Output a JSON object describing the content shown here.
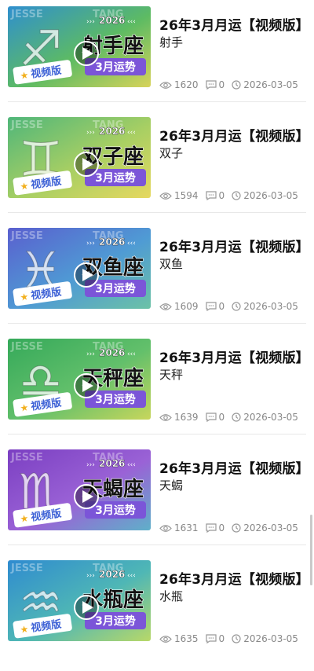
{
  "items": [
    {
      "title": "26年3月月运【视频版】",
      "subtitle": "射手",
      "views": "1620",
      "comments": "0",
      "date": "2026-03-05",
      "thumb": {
        "sign_name": "射手座",
        "year": "2026",
        "label": "3月运势",
        "badge": "视频版",
        "glyph": "♐",
        "watermark_left": "JESSE",
        "watermark_right": "TANG",
        "bg_a": "#2f8fcf",
        "bg_b": "#5dbb63",
        "bg_c": "#d7d35a",
        "symbol": "sagittarius-icon"
      }
    },
    {
      "title": "26年3月月运【视频版】",
      "subtitle": "双子",
      "views": "1594",
      "comments": "0",
      "date": "2026-03-05",
      "thumb": {
        "sign_name": "双子座",
        "year": "2026",
        "label": "3月运势",
        "badge": "视频版",
        "glyph": "♊",
        "watermark_left": "JESSE",
        "watermark_right": "TANG",
        "bg_a": "#4fb67a",
        "bg_b": "#a8cf63",
        "bg_c": "#e6d860",
        "symbol": "gemini-icon"
      }
    },
    {
      "title": "26年3月月运【视频版】",
      "subtitle": "双鱼",
      "views": "1609",
      "comments": "0",
      "date": "2026-03-05",
      "thumb": {
        "sign_name": "双鱼座",
        "year": "2026",
        "label": "3月运势",
        "badge": "视频版",
        "glyph": "♓",
        "watermark_left": "JESSE",
        "watermark_right": "TANG",
        "bg_a": "#5a5fcf",
        "bg_b": "#4f9bd4",
        "bg_c": "#6cc2a6",
        "symbol": "pisces-icon"
      }
    },
    {
      "title": "26年3月月运【视频版】",
      "subtitle": "天秤",
      "views": "1639",
      "comments": "0",
      "date": "2026-03-05",
      "thumb": {
        "sign_name": "天秤座",
        "year": "2026",
        "label": "3月运势",
        "badge": "视频版",
        "glyph": "♎",
        "watermark_left": "JESSE",
        "watermark_right": "TANG",
        "bg_a": "#35a95a",
        "bg_b": "#63c06b",
        "bg_c": "#c7d65c",
        "symbol": "libra-icon"
      }
    },
    {
      "title": "26年3月月运【视频版】",
      "subtitle": "天蝎",
      "views": "1631",
      "comments": "0",
      "date": "2026-03-05",
      "thumb": {
        "sign_name": "天蝎座",
        "year": "2026",
        "label": "3月运势",
        "badge": "视频版",
        "glyph": "♏",
        "watermark_left": "JESSE",
        "watermark_right": "TANG",
        "bg_a": "#7b3fc2",
        "bg_b": "#9a62d6",
        "bg_c": "#5fb0c9",
        "symbol": "scorpio-icon"
      }
    },
    {
      "title": "26年3月月运【视频版】",
      "subtitle": "水瓶",
      "views": "1635",
      "comments": "0",
      "date": "2026-03-05",
      "thumb": {
        "sign_name": "水瓶座",
        "year": "2026",
        "label": "3月运势",
        "badge": "视频版",
        "glyph": "♒",
        "watermark_left": "JESSE",
        "watermark_right": "TANG",
        "bg_a": "#2f8bd0",
        "bg_b": "#4fb7b5",
        "bg_c": "#b8d868",
        "symbol": "aquarius-icon"
      }
    }
  ]
}
